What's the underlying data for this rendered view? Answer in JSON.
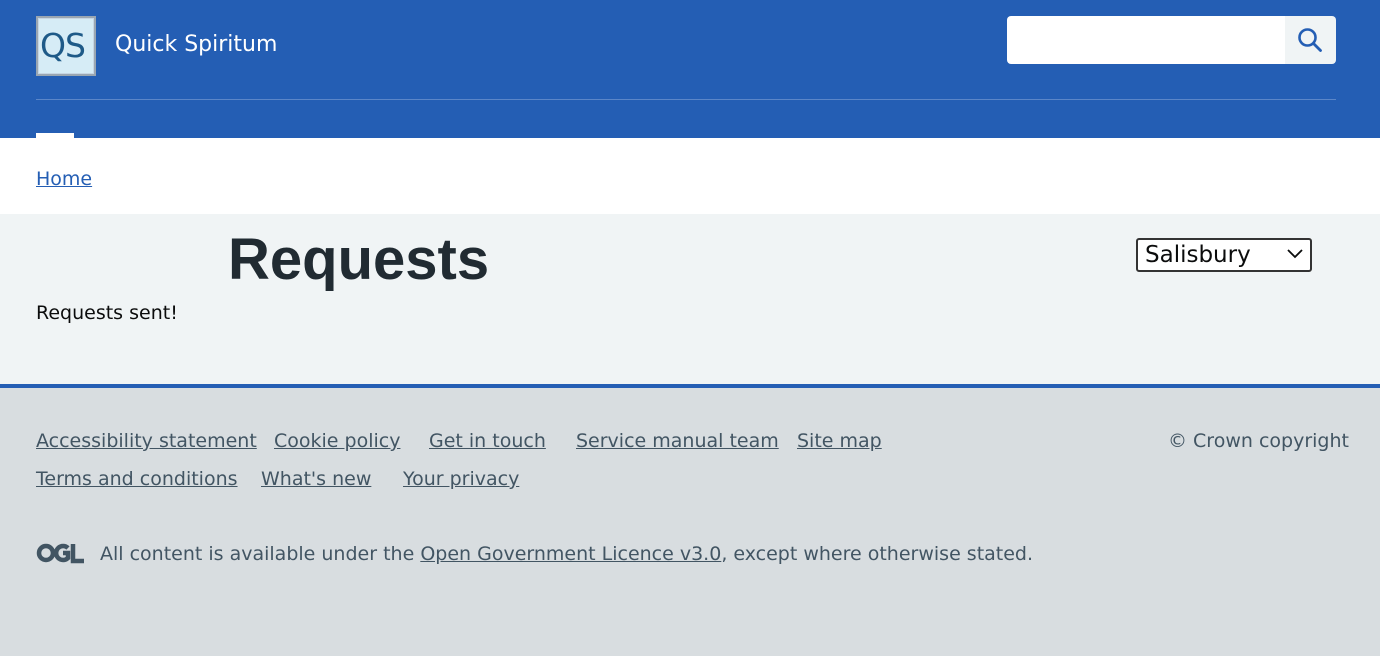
{
  "header": {
    "logo_text": "QS",
    "site_name": "Quick Spiritum",
    "search": {
      "placeholder": "",
      "value": ""
    },
    "search_icon": "search-icon"
  },
  "breadcrumb": {
    "home_label": "Home"
  },
  "main": {
    "title": "Requests",
    "status": "Requests sent!",
    "location_select": {
      "selected": "Salisbury"
    }
  },
  "footer": {
    "links_row1": [
      "Accessibility statement",
      "Cookie policy",
      "Get in touch",
      "Service manual team",
      "Site map"
    ],
    "links_row2": [
      "Terms and conditions",
      "What's new",
      "Your privacy"
    ],
    "copyright": "© Crown copyright",
    "licence_prefix": "All content is available under the ",
    "licence_link": "Open Government Licence v3.0",
    "licence_suffix": ", except where otherwise stated.",
    "ogl_icon": "ogl-logo-icon"
  },
  "colors": {
    "header_blue": "#245eb4",
    "page_grey": "#f0f4f5",
    "footer_grey": "#d8dde0",
    "footer_text": "#425563"
  }
}
